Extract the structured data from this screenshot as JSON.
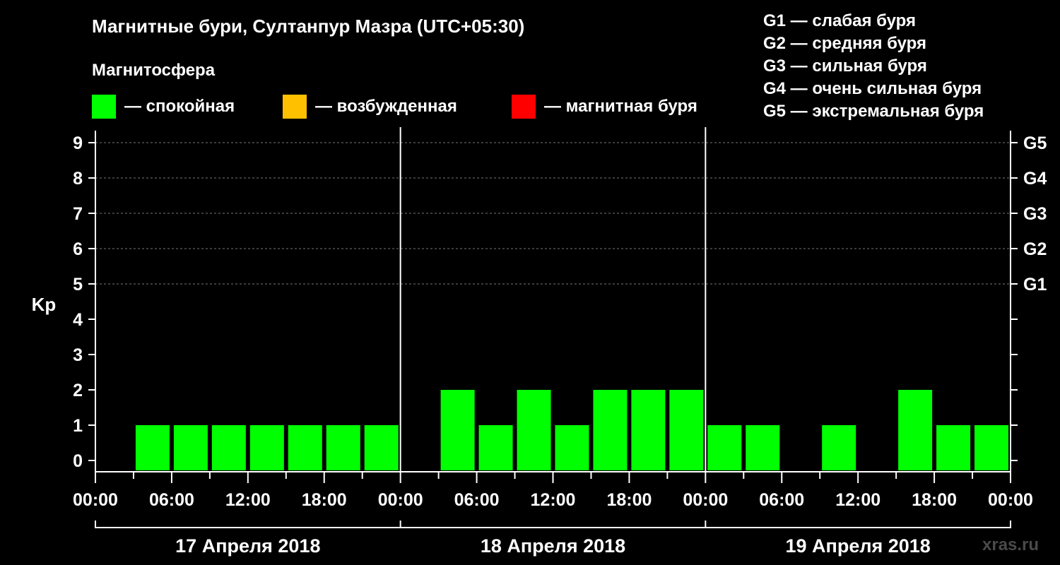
{
  "header": {
    "title": "Магнитные бури, Султанпур Мазра (UTC+05:30)",
    "subtitle": "Магнитосфера"
  },
  "legend": [
    {
      "label": "— спокойная",
      "color": "#00ff00"
    },
    {
      "label": "— возбужденная",
      "color": "#ffc000"
    },
    {
      "label": "— магнитная буря",
      "color": "#ff0000"
    }
  ],
  "g_legend": [
    "G1 — слабая буря",
    "G2 — средняя буря",
    "G3 — сильная буря",
    "G4 — очень сильная буря",
    "G5 — экстремальная буря"
  ],
  "watermark": "xras.ru",
  "chart_data": {
    "type": "bar",
    "ylabel": "Kp",
    "ylim": [
      0,
      9
    ],
    "yticks": [
      "0",
      "1",
      "2",
      "3",
      "4",
      "5",
      "6",
      "7",
      "8",
      "9"
    ],
    "right_labels": [
      {
        "kp": 5,
        "label": "G1"
      },
      {
        "kp": 6,
        "label": "G2"
      },
      {
        "kp": 7,
        "label": "G3"
      },
      {
        "kp": 8,
        "label": "G4"
      },
      {
        "kp": 9,
        "label": "G5"
      }
    ],
    "xticks": [
      "00:00",
      "06:00",
      "12:00",
      "18:00",
      "00:00",
      "06:00",
      "12:00",
      "18:00",
      "00:00",
      "06:00",
      "12:00",
      "18:00",
      "00:00"
    ],
    "days": [
      "17 Апреля 2018",
      "18 Апреля 2018",
      "19 Апреля 2018"
    ],
    "interval_hours": 3,
    "bar_color": "#00ff00",
    "values": [
      0,
      1,
      1,
      1,
      1,
      1,
      1,
      1,
      0,
      2,
      1,
      2,
      1,
      2,
      2,
      2,
      1,
      1,
      0,
      1,
      0,
      2,
      1,
      1
    ],
    "grid": "dashed horizontal"
  }
}
